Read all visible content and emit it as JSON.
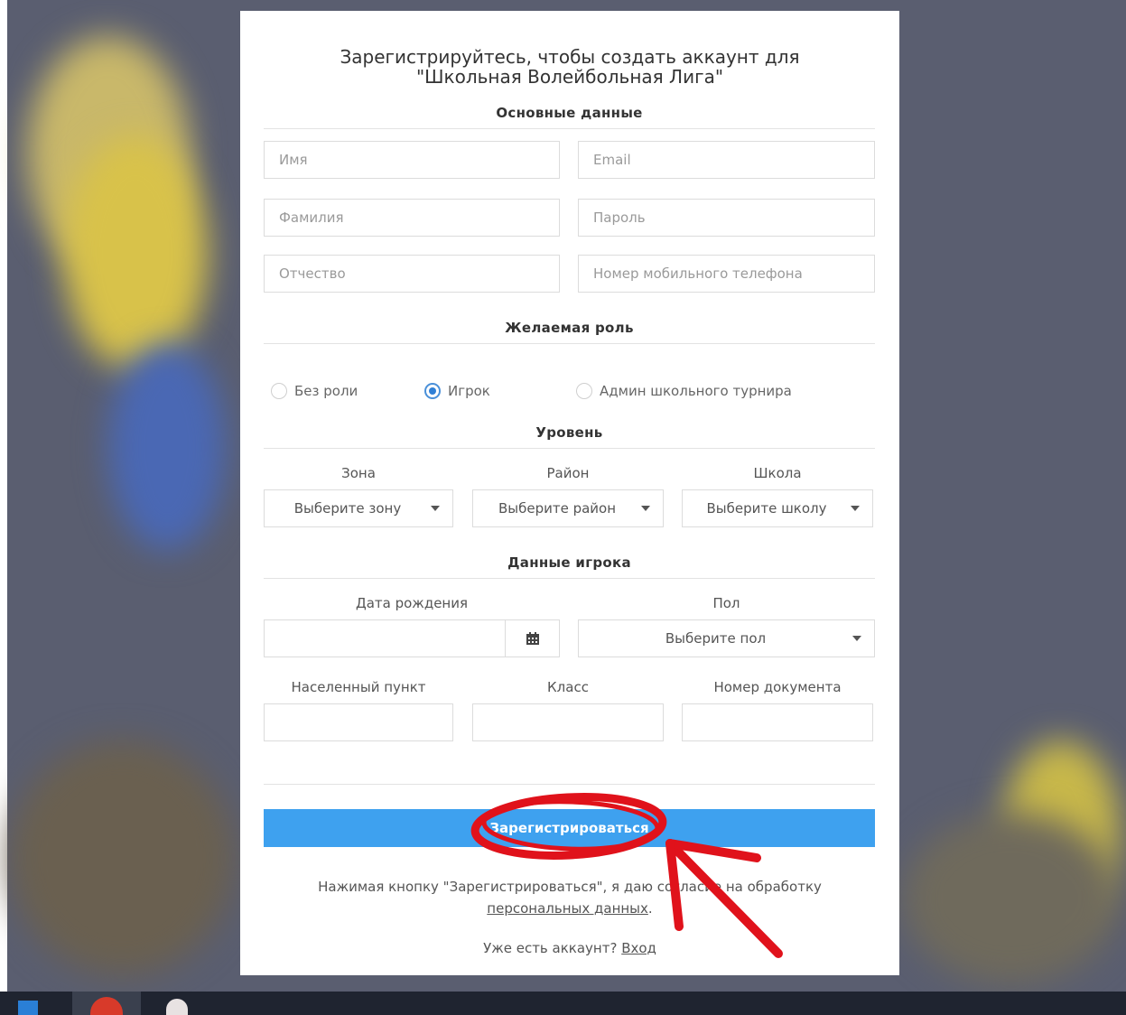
{
  "form": {
    "title_line1": "Зарегистрируйтесь, чтобы создать аккаунт для",
    "title_line2": "\"Школьная Волейбольная Лига\"",
    "section_basic": "Основные данные",
    "first_name_placeholder": "Имя",
    "email_placeholder": "Email",
    "last_name_placeholder": "Фамилия",
    "password_placeholder": "Пароль",
    "middle_name_placeholder": "Отчество",
    "phone_placeholder": "Номер мобильного телефона",
    "section_role": "Желаемая роль",
    "roles": [
      {
        "label": "Без роли",
        "selected": false
      },
      {
        "label": "Игрок",
        "selected": true
      },
      {
        "label": "Админ школьного турнира",
        "selected": false
      }
    ],
    "section_level": "Уровень",
    "zone_label": "Зона",
    "zone_select": "Выберите зону",
    "district_label": "Район",
    "district_select": "Выберите район",
    "school_label": "Школа",
    "school_select": "Выберите школу",
    "section_player": "Данные игрока",
    "birthdate_label": "Дата рождения",
    "gender_label": "Пол",
    "gender_select": "Выберите пол",
    "locality_label": "Населенный пункт",
    "class_label": "Класс",
    "document_label": "Номер документа",
    "submit_label": "Зарегистрироваться",
    "consent_text": "Нажимая кнопку \"Зарегистрироваться\", я даю согласие на обработку",
    "consent_link": "персональных данных",
    "consent_end": ".",
    "have_account": "Уже есть аккаунт?",
    "login_link": "Вход"
  },
  "colors": {
    "accent": "#3ea1ef",
    "annotation": "#e0121b",
    "background": "#5a5e70"
  }
}
